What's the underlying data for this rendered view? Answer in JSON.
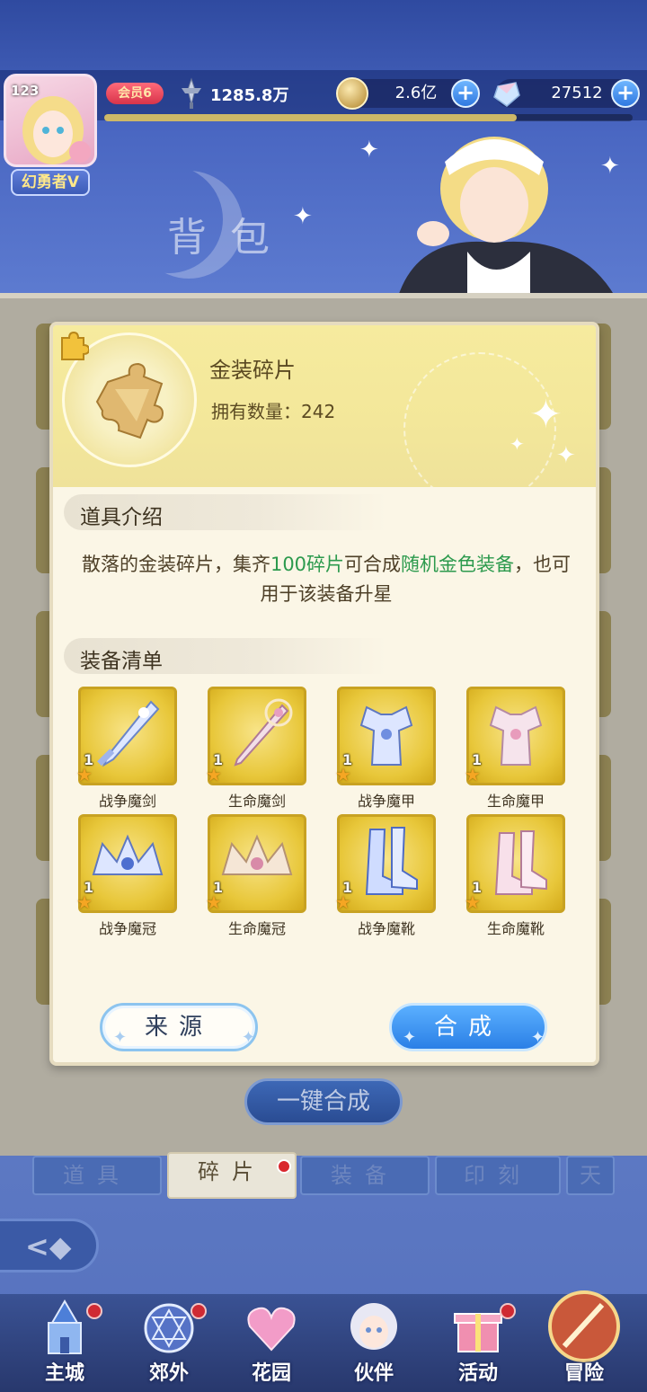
{
  "hud": {
    "avatar_level": "123",
    "player_title": "幻勇者V",
    "vip_label": "会员6",
    "power": "1285.8万",
    "gold": "2.6亿",
    "gems": "27512",
    "plus": "+",
    "exp_progress": 0.78
  },
  "page_title": "背包",
  "background": {
    "one_key_compose": "一键合成",
    "tabs": [
      {
        "label": "道具",
        "active": false
      },
      {
        "label": "碎片",
        "active": true
      },
      {
        "label": "装备",
        "active": false
      },
      {
        "label": "印刻",
        "active": false
      },
      {
        "label": "天",
        "active": false
      }
    ]
  },
  "modal": {
    "item_name": "金装碎片",
    "count_label": "拥有数量",
    "count_value": "242",
    "intro_title": "道具介绍",
    "desc_part1": "散落的金装碎片，集齐",
    "desc_highlight1": "100碎片",
    "desc_part2": "可合成",
    "desc_highlight2": "随机金色装备",
    "desc_part3": "，也可用于该装备升星",
    "list_title": "装备清单",
    "equipment": [
      {
        "name": "战争魔剑",
        "star": "1",
        "icon": "sword-icon"
      },
      {
        "name": "生命魔剑",
        "star": "1",
        "icon": "staff-icon"
      },
      {
        "name": "战争魔甲",
        "star": "1",
        "icon": "armor-icon"
      },
      {
        "name": "生命魔甲",
        "star": "1",
        "icon": "armor-icon"
      },
      {
        "name": "战争魔冠",
        "star": "1",
        "icon": "crown-icon"
      },
      {
        "name": "生命魔冠",
        "star": "1",
        "icon": "crown-icon"
      },
      {
        "name": "战争魔靴",
        "star": "1",
        "icon": "boots-icon"
      },
      {
        "name": "生命魔靴",
        "star": "1",
        "icon": "boots-icon"
      }
    ],
    "source_button": "来源",
    "compose_button": "合成"
  },
  "nav": [
    {
      "label": "主城",
      "icon": "castle-icon"
    },
    {
      "label": "郊外",
      "icon": "magic-circle-icon"
    },
    {
      "label": "花园",
      "icon": "heart-icon"
    },
    {
      "label": "伙伴",
      "icon": "partner-avatar-icon"
    },
    {
      "label": "活动",
      "icon": "gift-icon"
    },
    {
      "label": "冒险",
      "icon": "sword-orb-icon"
    }
  ],
  "colors": {
    "highlight_green": "#2c9a4d",
    "gold_tile": "#e8c73a",
    "compose_blue": "#2b7fe6"
  }
}
